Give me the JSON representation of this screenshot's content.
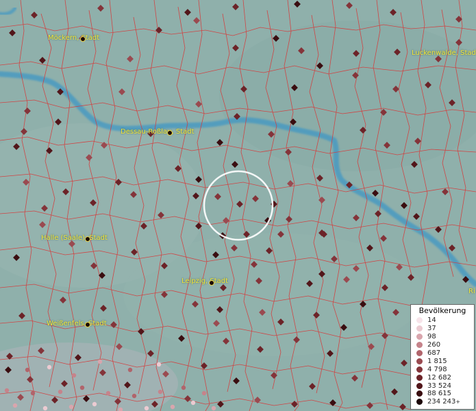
{
  "map": {
    "cities": [
      {
        "name": "Möckern, Stadt"
      },
      {
        "name": "Luckenwalde, Stadt"
      },
      {
        "name": "Dessau-Roßlau, Stadt"
      },
      {
        "name": "Halle (Saale), Stadt"
      },
      {
        "name": "Leipzig, Stadt"
      },
      {
        "name": "Weißenfels, Stadt"
      },
      {
        "name": "Ri"
      }
    ]
  },
  "legend": {
    "title": "Bevölkerung",
    "items": [
      {
        "label": "14",
        "color": "#f7e4ea"
      },
      {
        "label": "37",
        "color": "#eccbd2"
      },
      {
        "label": "98",
        "color": "#d9a5ad"
      },
      {
        "label": "260",
        "color": "#c6838b"
      },
      {
        "label": "687",
        "color": "#b1646b"
      },
      {
        "label": "1 815",
        "color": "#9a4a50"
      },
      {
        "label": "4 798",
        "color": "#84343a"
      },
      {
        "label": "12 682",
        "color": "#6c2328"
      },
      {
        "label": "33 524",
        "color": "#52161a"
      },
      {
        "label": "88 615",
        "color": "#3a0d10"
      },
      {
        "label": "234 243",
        "color": "#1c0608",
        "suffix": "+"
      }
    ]
  }
}
